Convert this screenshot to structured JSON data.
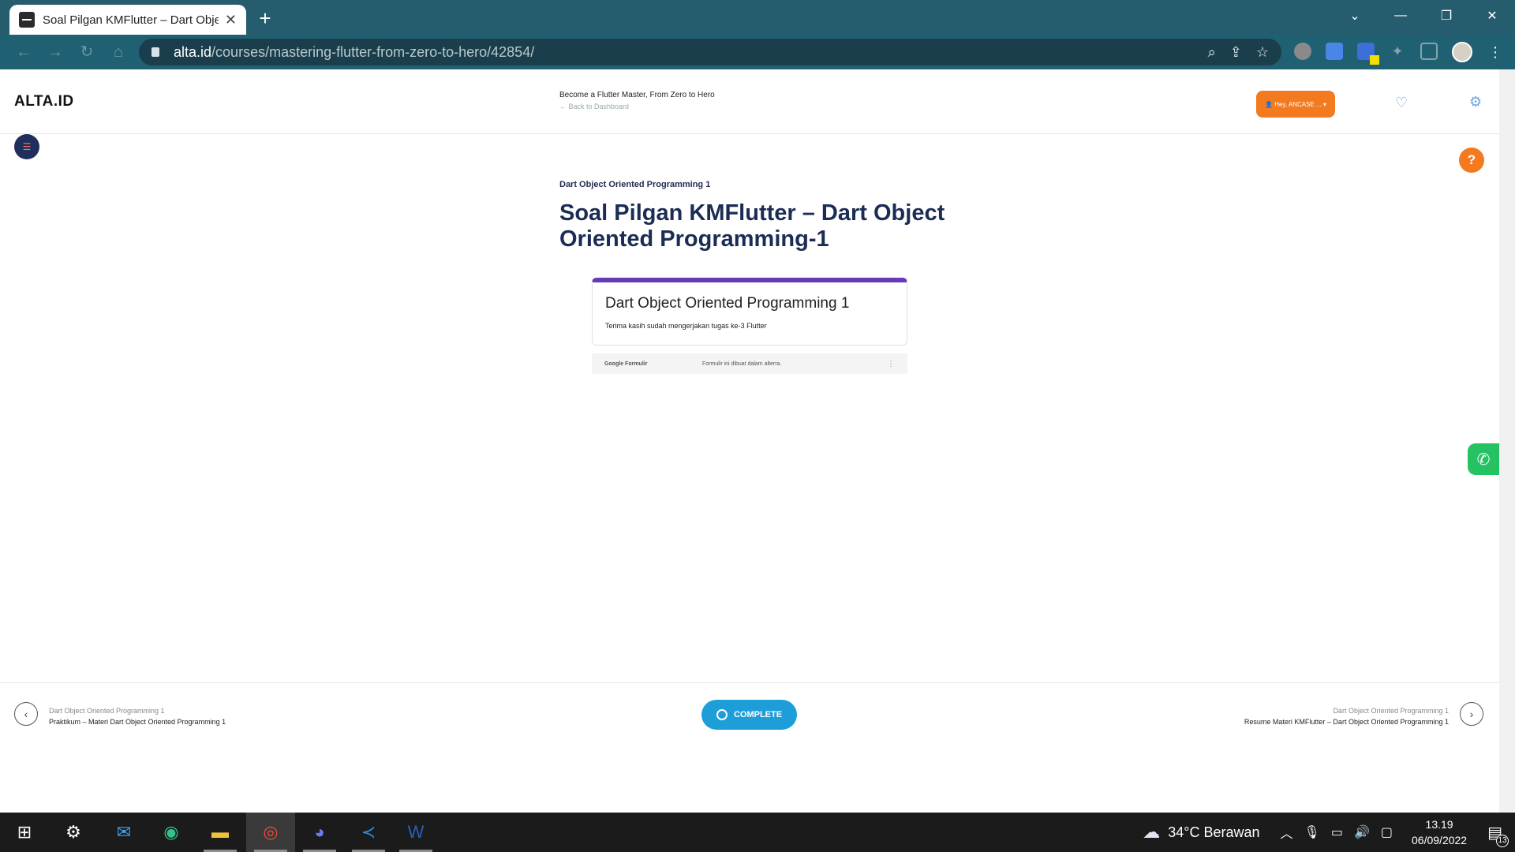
{
  "browser": {
    "tab_title": "Soal Pilgan KMFlutter – Dart Obje",
    "url_domain": "alta.id",
    "url_path": "/courses/mastering-flutter-from-zero-to-hero/42854/"
  },
  "header": {
    "logo": "ALTA.ID",
    "course_title": "Become a Flutter Master, From Zero to Hero",
    "back_link": "← Back to Dashboard",
    "user_button": "👤 Hey, ANCASE ... ▾"
  },
  "lesson": {
    "section": "Dart Object Oriented Programming 1",
    "title": "Soal Pilgan KMFlutter – Dart Object Oriented Programming-1"
  },
  "form": {
    "title": "Dart Object Oriented Programming 1",
    "description": "Terima kasih sudah mengerjakan tugas ke-3 Flutter",
    "brand": "Google Formulir",
    "footer_note": "Formulir ini dibuat dalam alterra."
  },
  "bottom_nav": {
    "prev_section": "Dart Object Oriented Programming 1",
    "prev_title": "Praktikum – Materi Dart Object Oriented Programming 1",
    "complete_label": "COMPLETE",
    "next_section": "Dart Object Oriented Programming 1",
    "next_title": "Resume Materi KMFlutter – Dart Object Oriented Programming 1"
  },
  "taskbar": {
    "weather": "34°C  Berawan",
    "time": "13.19",
    "date": "06/09/2022",
    "notification_count": "13"
  },
  "colors": {
    "accent_orange": "#f47a1f",
    "primary_navy": "#1b2c55",
    "complete_blue": "#1e9ed9",
    "form_purple": "#673ab7",
    "whatsapp_green": "#25c264"
  }
}
